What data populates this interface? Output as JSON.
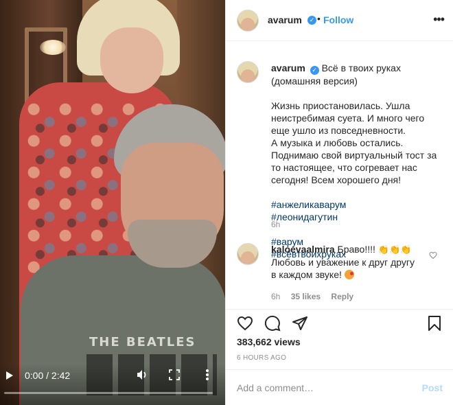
{
  "video": {
    "time": "0:00 / 2:42",
    "progress": 0,
    "shirt_print": "THE BEATLES"
  },
  "header": {
    "username": "avarum",
    "dot": "•",
    "follow_label": "Follow",
    "options_icon": "more-horizontal-icon"
  },
  "caption": {
    "username": "avarum",
    "title_line": "Всё в твоих руках\n(домашняя версия)",
    "body": "Жизнь приостановилась. Ушла неистребимая суета. И много чего еще ушло из повседневности.\nА музыка и любовь остались.\nПоднимаю свой виртуальный тост за то настоящее, что согревает нас сегодня! Всем хорошего дня!",
    "hashtags": [
      "#анжеликаварум",
      "#леонидагутин",
      "#варум",
      "#всёвтвоихруках"
    ],
    "time": "6h"
  },
  "comment": {
    "username": "kaloevaalmira",
    "text_start": "Браво!!!!",
    "emojis": [
      "👏",
      "👏",
      "👏"
    ],
    "text_end": "Любовь и уважение к друг другу в каждом звуке!",
    "time": "6h",
    "likes": "35 likes",
    "reply_label": "Reply"
  },
  "stats": {
    "views": "383,662 views",
    "posted": "6 HOURS AGO"
  },
  "add_comment": {
    "placeholder": "Add a comment…",
    "post_label": "Post"
  },
  "colors": {
    "link": "#3897f0",
    "hashtag": "#00376b",
    "muted": "#8e8e8e",
    "post_disabled": "#b3dbff"
  }
}
